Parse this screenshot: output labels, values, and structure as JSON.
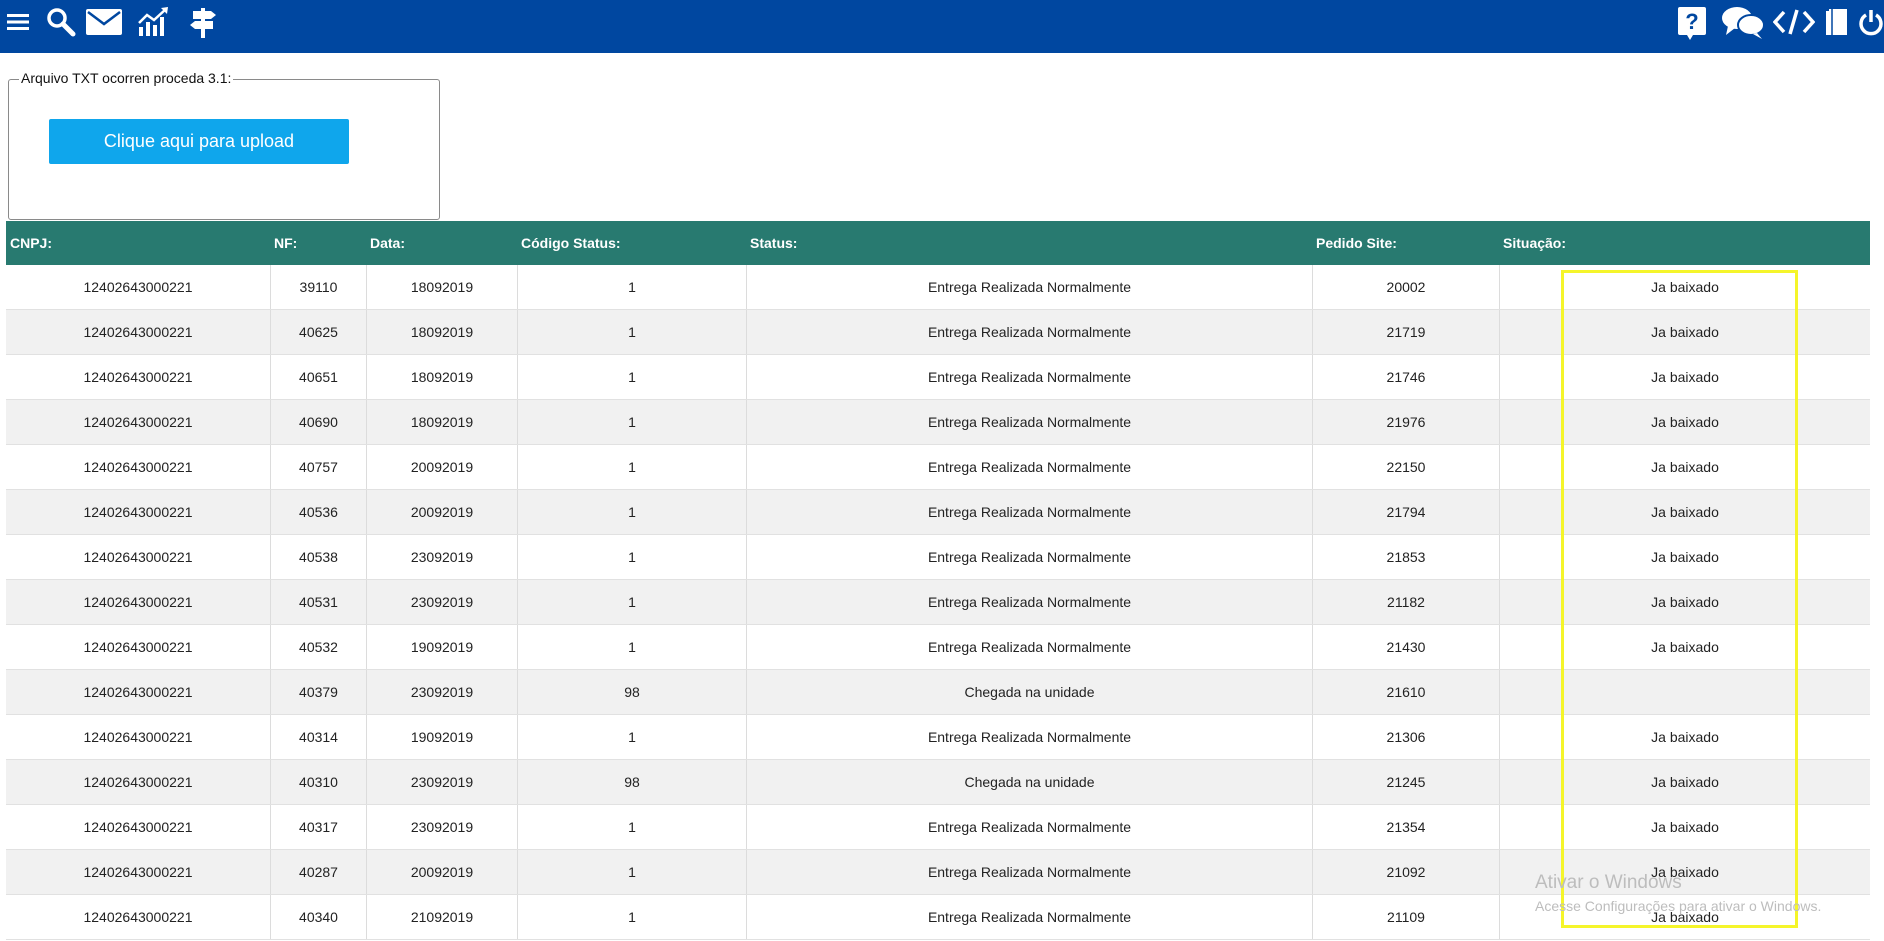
{
  "toolbar": {
    "left_icons": [
      "menu-icon",
      "search-icon",
      "mail-icon",
      "chart-icon",
      "signpost-icon"
    ],
    "right_icons": [
      "help-icon",
      "chat-icon",
      "code-icon",
      "book-icon",
      "power-icon"
    ]
  },
  "upload": {
    "legend": "Arquivo TXT ocorren proceda 3.1:",
    "button_label": "Clique aqui para upload"
  },
  "table": {
    "headers": [
      "CNPJ:",
      "NF:",
      "Data:",
      "Código Status:",
      "Status:",
      "Pedido Site:",
      "Situação:"
    ],
    "rows": [
      [
        "12402643000221",
        "39110",
        "18092019",
        "1",
        "Entrega Realizada Normalmente",
        "20002",
        "Ja baixado"
      ],
      [
        "12402643000221",
        "40625",
        "18092019",
        "1",
        "Entrega Realizada Normalmente",
        "21719",
        "Ja baixado"
      ],
      [
        "12402643000221",
        "40651",
        "18092019",
        "1",
        "Entrega Realizada Normalmente",
        "21746",
        "Ja baixado"
      ],
      [
        "12402643000221",
        "40690",
        "18092019",
        "1",
        "Entrega Realizada Normalmente",
        "21976",
        "Ja baixado"
      ],
      [
        "12402643000221",
        "40757",
        "20092019",
        "1",
        "Entrega Realizada Normalmente",
        "22150",
        "Ja baixado"
      ],
      [
        "12402643000221",
        "40536",
        "20092019",
        "1",
        "Entrega Realizada Normalmente",
        "21794",
        "Ja baixado"
      ],
      [
        "12402643000221",
        "40538",
        "23092019",
        "1",
        "Entrega Realizada Normalmente",
        "21853",
        "Ja baixado"
      ],
      [
        "12402643000221",
        "40531",
        "23092019",
        "1",
        "Entrega Realizada Normalmente",
        "21182",
        "Ja baixado"
      ],
      [
        "12402643000221",
        "40532",
        "19092019",
        "1",
        "Entrega Realizada Normalmente",
        "21430",
        "Ja baixado"
      ],
      [
        "12402643000221",
        "40379",
        "23092019",
        "98",
        "Chegada na unidade",
        "21610",
        ""
      ],
      [
        "12402643000221",
        "40314",
        "19092019",
        "1",
        "Entrega Realizada Normalmente",
        "21306",
        "Ja baixado"
      ],
      [
        "12402643000221",
        "40310",
        "23092019",
        "98",
        "Chegada na unidade",
        "21245",
        "Ja baixado"
      ],
      [
        "12402643000221",
        "40317",
        "23092019",
        "1",
        "Entrega Realizada Normalmente",
        "21354",
        "Ja baixado"
      ],
      [
        "12402643000221",
        "40287",
        "20092019",
        "1",
        "Entrega Realizada Normalmente",
        "21092",
        "Ja baixado"
      ],
      [
        "12402643000221",
        "40340",
        "21092019",
        "1",
        "Entrega Realizada Normalmente",
        "21109",
        "Ja baixado"
      ]
    ]
  },
  "watermark": {
    "line1": "Ativar o Windows",
    "line2": "Acesse Configurações para ativar o Windows."
  },
  "colors": {
    "topbar": "#0047a0",
    "table_header": "#287a70",
    "upload_button": "#0fa6ec",
    "highlight": "#f5f52a"
  }
}
